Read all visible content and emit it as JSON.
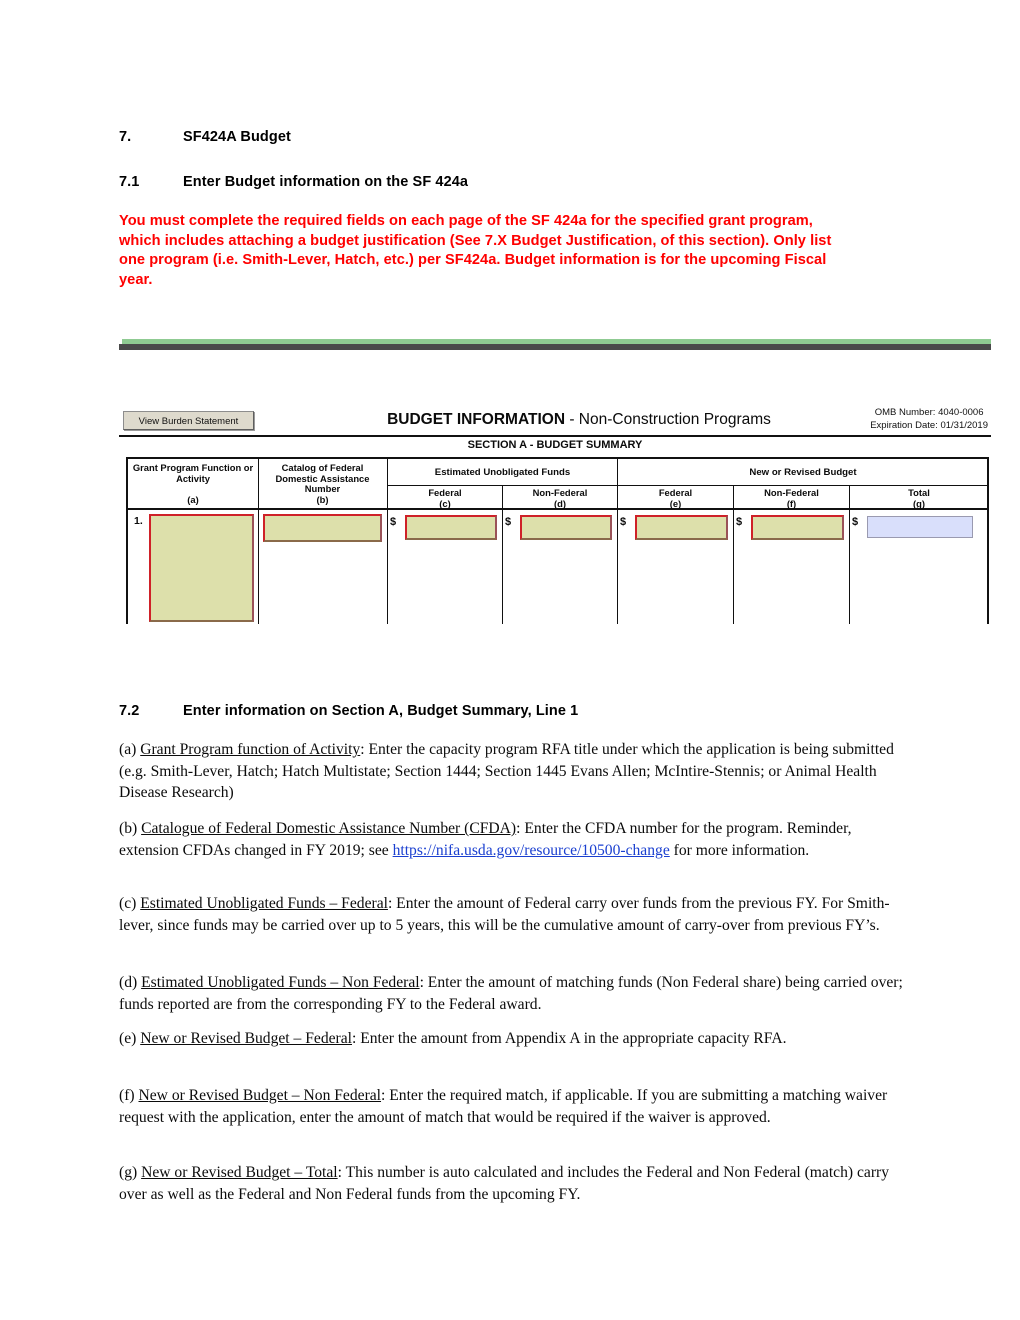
{
  "document": {
    "section_heading": {
      "number": "7.",
      "title": "SF424A Budget"
    },
    "sub_heading": {
      "number": "7.1",
      "title": "Enter Budget information on the SF 424a"
    },
    "warning": "You must complete the required fields on each page of the SF 424a for the specified grant program, which includes attaching a budget justification (See 7.X Budget Justification, of this section).  Only list one program (i.e. Smith-Lever, Hatch, etc.) per SF424a.  Budget information is for the upcoming Fiscal year.",
    "warning_color": "#ff0000"
  },
  "form": {
    "burden_button_label": "View Burden Statement",
    "title_bold": "BUDGET INFORMATION",
    "title_rest": " - Non-Construction Programs",
    "omb_number": "OMB Number: 4040-0006",
    "expiration_date": "Expiration Date: 01/31/2019",
    "section_title": "SECTION A - BUDGET SUMMARY",
    "accent_bar_color": "#8fcb92",
    "field_fill_color": "#dde0ab",
    "field_border_color": "#cf2128",
    "total_field_fill_color": "#d9dffb",
    "headers": {
      "col_a": "Grant Program Function or Activity",
      "col_a_letter": "(a)",
      "col_b": "Catalog of Federal Domestic Assistance Number",
      "col_b_letter": "(b)",
      "group_unobligated": "Estimated Unobligated Funds",
      "group_new_revised": "New or Revised Budget",
      "col_c": "Federal",
      "col_c_letter": "(c)",
      "col_d": "Non-Federal",
      "col_d_letter": "(d)",
      "col_e": "Federal",
      "col_e_letter": "(e)",
      "col_f": "Non-Federal",
      "col_f_letter": "(f)",
      "col_g": "Total",
      "col_g_letter": "(g)"
    },
    "row": {
      "number": "1.",
      "currency_symbol": "$",
      "grant_program_value": "",
      "cfda_value": "",
      "unobligated_federal_value": "",
      "unobligated_nonfederal_value": "",
      "new_federal_value": "",
      "new_nonfederal_value": "",
      "total_value": ""
    }
  },
  "instructions": {
    "heading": {
      "number": "7.2",
      "title": "Enter information on Section A, Budget Summary, Line 1"
    },
    "items": [
      {
        "marker": "(a)",
        "term": "Grant Program function of Activity",
        "body": ":  Enter the capacity program RFA title under which the application is being submitted (e.g. Smith-Lever, Hatch; Hatch Multistate; Section 1444; Section 1445 Evans Allen; McIntire-Stennis; or Animal Health Disease Research)"
      },
      {
        "marker": "(b)",
        "term": "Catalogue of Federal Domestic Assistance Number (CFDA)",
        "body": ":  Enter the CFDA number for the program. Reminder, extension CFDAs changed in FY 2019; see ",
        "link_text": "https://nifa.usda.gov/resource/10500-change",
        "body_after": " for more information."
      },
      {
        "marker": "(c)",
        "term": "Estimated Unobligated Funds – Federal",
        "body": ":  Enter the amount of Federal carry over funds from the previous FY.  For Smith-lever, since funds may be carried over up to 5 years, this will be the cumulative amount of carry-over from previous FY’s."
      },
      {
        "marker": "(d)",
        "term": "Estimated Unobligated Funds – Non Federal",
        "body": ":  Enter the amount of matching funds (Non Federal share) being carried over; funds reported are from the corresponding FY to the Federal award."
      },
      {
        "marker": "(e)",
        "term": "New or Revised Budget – Federal",
        "body": ":  Enter the amount from Appendix A in the appropriate capacity RFA."
      },
      {
        "marker": "(f)",
        "term": "New or Revised Budget – Non Federal",
        "body": ":  Enter the required match, if applicable.  If you are submitting a matching waiver request with the application, enter the amount of match that would be required if the waiver is approved."
      },
      {
        "marker": "(g)",
        "term": "New or Revised Budget – Total",
        "body": ":  This number is auto calculated and includes the Federal and Non Federal (match) carry over as well as the Federal and Non Federal funds from the upcoming FY."
      }
    ]
  }
}
